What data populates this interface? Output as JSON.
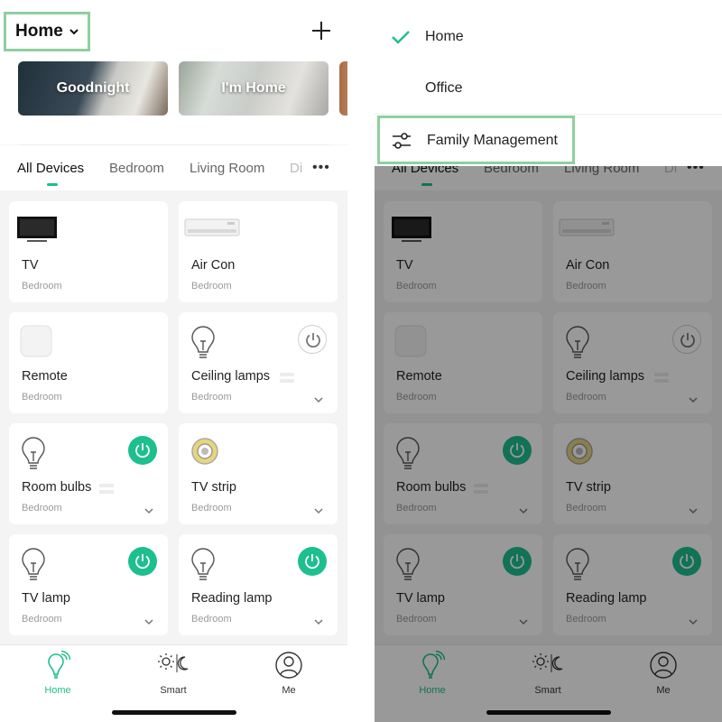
{
  "header": {
    "home_title": "Home",
    "scenes": [
      {
        "label": "Goodnight"
      },
      {
        "label": "I'm Home"
      }
    ]
  },
  "tabs": [
    "All Devices",
    "Bedroom",
    "Living Room",
    "Di"
  ],
  "devices": [
    {
      "name": "TV",
      "room": "Bedroom",
      "icon": "tv-icon",
      "power": "none"
    },
    {
      "name": "Air Con",
      "room": "Bedroom",
      "icon": "air-conditioner-icon",
      "power": "none"
    },
    {
      "name": "Remote",
      "room": "Bedroom",
      "icon": "remote-hub-icon",
      "power": "none"
    },
    {
      "name": "Ceiling lamps",
      "room": "Bedroom",
      "icon": "bulb-icon",
      "power": "off"
    },
    {
      "name": "Room bulbs",
      "room": "Bedroom",
      "icon": "bulb-icon",
      "power": "on"
    },
    {
      "name": "TV strip",
      "room": "Bedroom",
      "icon": "led-strip-icon",
      "power": "none"
    },
    {
      "name": "TV lamp",
      "room": "Bedroom",
      "icon": "bulb-icon",
      "power": "on"
    },
    {
      "name": "Reading lamp",
      "room": "Bedroom",
      "icon": "bulb-icon",
      "power": "on"
    }
  ],
  "tabbar": {
    "home": "Home",
    "smart": "Smart",
    "me": "Me"
  },
  "menu": {
    "items": [
      "Home",
      "Office"
    ],
    "selected": "Home",
    "family_management": "Family Management"
  },
  "colors": {
    "accent": "#1dbf8f",
    "highlight": "#8fcfa0"
  }
}
